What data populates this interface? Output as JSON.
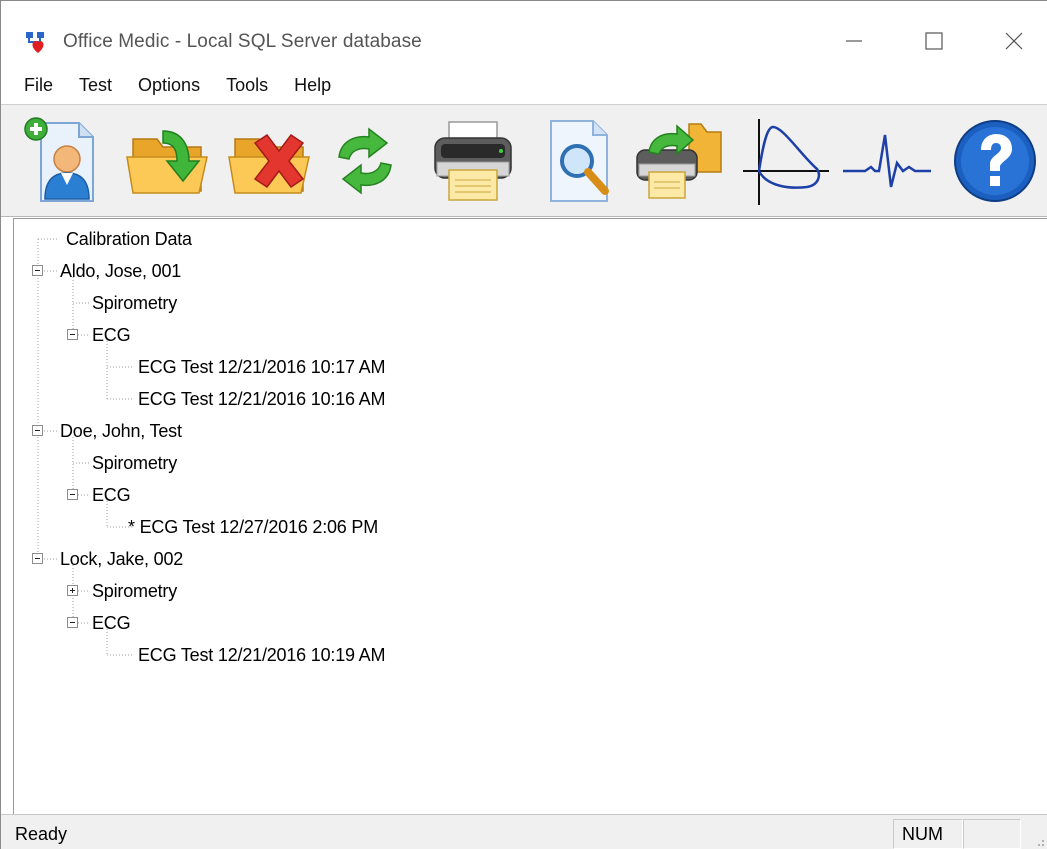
{
  "window": {
    "title": "Office Medic - Local SQL Server database",
    "controls": {
      "minimize": "minimize",
      "maximize": "maximize",
      "close": "close"
    }
  },
  "menu": [
    "File",
    "Test",
    "Options",
    "Tools",
    "Help"
  ],
  "toolbar": [
    {
      "icon": "new-patient-icon"
    },
    {
      "icon": "open-folder-icon"
    },
    {
      "icon": "delete-icon"
    },
    {
      "icon": "refresh-icon"
    },
    {
      "icon": "print-icon"
    },
    {
      "icon": "print-preview-icon"
    },
    {
      "icon": "print-to-file-icon"
    },
    {
      "icon": "spirometry-loop-icon"
    },
    {
      "icon": "ecg-waveform-icon"
    },
    {
      "icon": "help-icon"
    }
  ],
  "tree": {
    "calibration": "Calibration Data",
    "patients": [
      {
        "label": "Aldo, Jose, 001",
        "spirometry": "Spirometry",
        "ecg": "ECG",
        "ecg_tests": [
          "ECG Test 12/21/2016 10:17 AM",
          "ECG Test 12/21/2016 10:16 AM"
        ]
      },
      {
        "label": "Doe, John, Test",
        "spirometry": "Spirometry",
        "ecg": "ECG",
        "ecg_tests": [
          "* ECG Test 12/27/2016 2:06 PM"
        ]
      },
      {
        "label": "Lock, Jake, 002",
        "spirometry": "Spirometry",
        "ecg": "ECG",
        "ecg_tests": [
          "ECG Test 12/21/2016 10:19 AM"
        ]
      }
    ]
  },
  "status": {
    "text": "Ready",
    "num": "NUM",
    "blank": ""
  },
  "colors": {
    "toolbar_bg": "#f0f0f0",
    "folder": "#f5b53a",
    "green_arrow": "#3ea832",
    "delete_red": "#d92b2b",
    "waveform_blue": "#1d3fa8",
    "help_blue": "#1b5fc0"
  }
}
